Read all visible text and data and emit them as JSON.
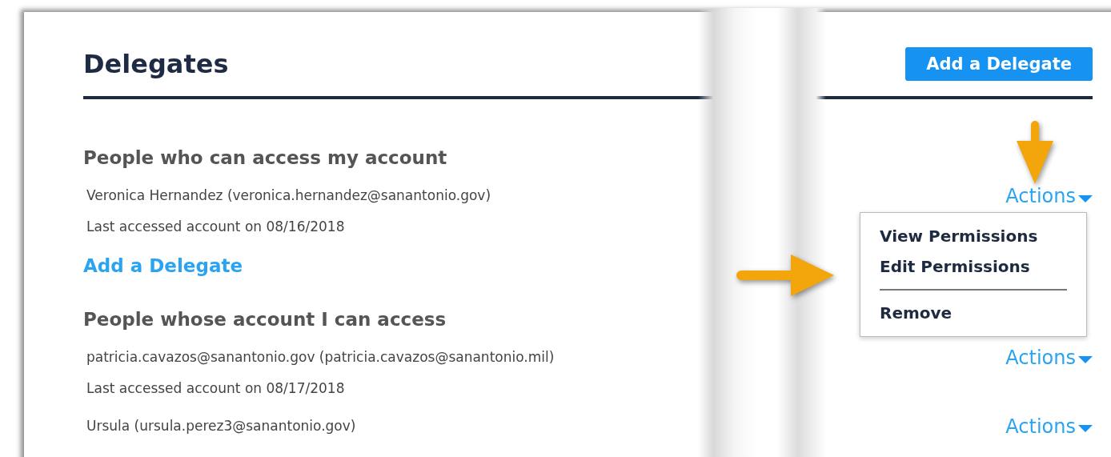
{
  "title": "Delegates",
  "add_button": "Add a Delegate",
  "sections": [
    {
      "heading": "People who can access my account",
      "delegates": [
        {
          "name": "Veronica Hernandez (veronica.hernandez@sanantonio.gov)",
          "last_accessed": "Last accessed account on 08/16/2018",
          "actions": "Actions",
          "menu_open": true
        }
      ],
      "add_link": "Add a Delegate"
    },
    {
      "heading": "People whose account I can access",
      "delegates": [
        {
          "name": "patricia.cavazos@sanantonio.gov (patricia.cavazos@sanantonio.mil)",
          "last_accessed": "Last accessed account on 08/17/2018",
          "actions": "Actions",
          "menu_open": false
        },
        {
          "name": "Ursula (ursula.perez3@sanantonio.gov)",
          "actions": "Actions",
          "menu_open": false
        }
      ]
    }
  ],
  "menu": [
    {
      "label": "View Permissions",
      "divider_before": false
    },
    {
      "label": "Edit Permissions",
      "divider_before": false
    },
    {
      "label": "Remove",
      "divider_before": true
    }
  ]
}
